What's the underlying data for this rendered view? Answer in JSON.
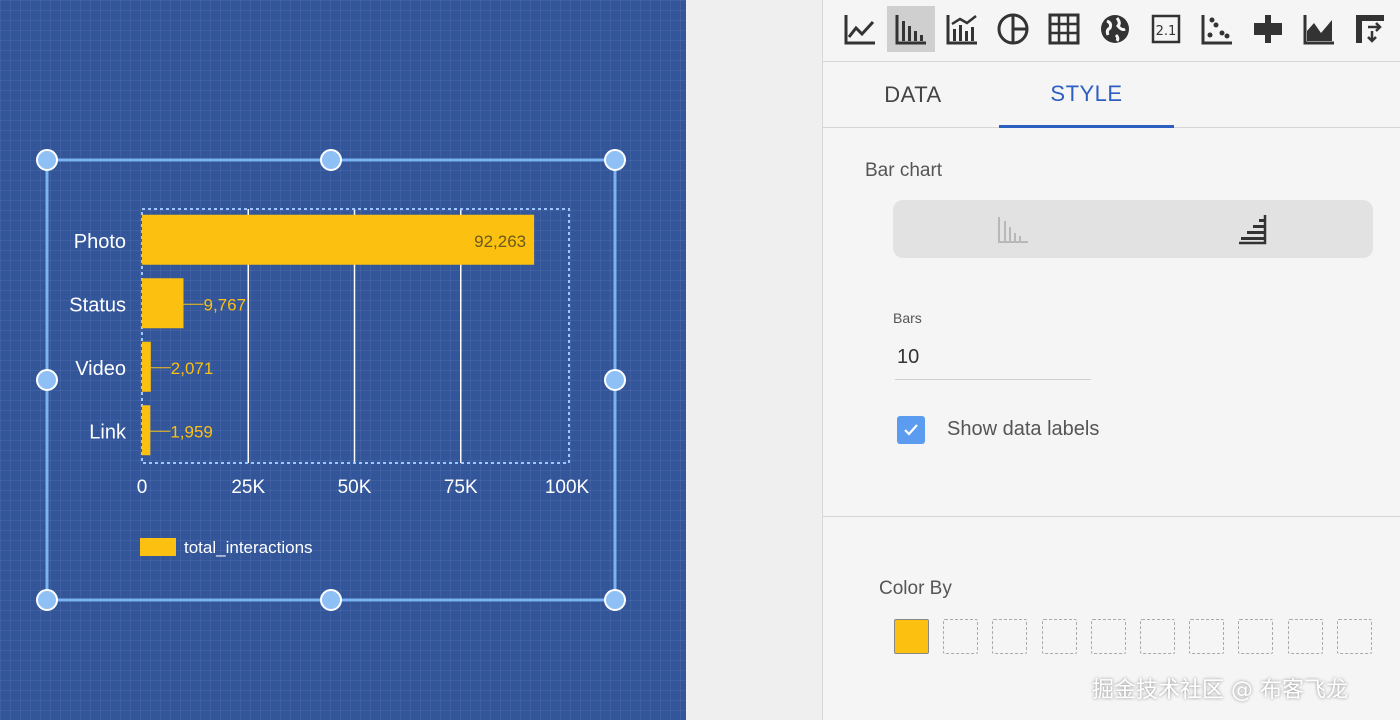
{
  "toolbar": {
    "icons": [
      "line-chart-icon",
      "bar-chart-icon",
      "combo-chart-icon",
      "pie-chart-icon",
      "table-icon",
      "geo-map-icon",
      "scorecard-icon",
      "scatter-chart-icon",
      "bullet-chart-icon",
      "area-chart-icon",
      "pivot-table-icon"
    ],
    "active": "bar-chart-icon",
    "scorecard_text": "2.1"
  },
  "tabs": {
    "data": "DATA",
    "style": "STYLE",
    "active": "style"
  },
  "style_panel": {
    "section_title": "Bar chart",
    "orientation": {
      "options": [
        "vertical-bars-icon",
        "horizontal-bars-icon"
      ],
      "selected": "horizontal-bars-icon"
    },
    "bars_label": "Bars",
    "bars_value": "10",
    "show_data_labels_label": "Show data labels",
    "show_data_labels_checked": true,
    "color_by_title": "Color By",
    "swatches": [
      "#fbc010",
      "",
      "",
      "",
      "",
      "",
      "",
      "",
      "",
      ""
    ]
  },
  "watermark": "掘金技术社区 @ 布客飞龙",
  "chart_data": {
    "type": "bar",
    "orientation": "horizontal",
    "categories": [
      "Photo",
      "Status",
      "Video",
      "Link"
    ],
    "series": [
      {
        "name": "total_interactions",
        "values": [
          92263,
          9767,
          2071,
          1959
        ],
        "color": "#fbc010"
      }
    ],
    "data_labels": [
      "92,263",
      "9,767",
      "2,071",
      "1,959"
    ],
    "xticks": [
      "0",
      "25K",
      "50K",
      "75K",
      "100K"
    ],
    "xlim": [
      0,
      100000
    ],
    "grid": true,
    "legend_position": "bottom-left"
  }
}
